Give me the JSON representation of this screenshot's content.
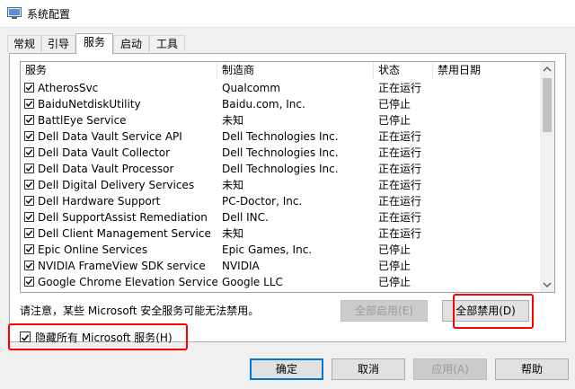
{
  "window": {
    "title": "系统配置"
  },
  "tabs": [
    "常规",
    "引导",
    "服务",
    "启动",
    "工具"
  ],
  "columns": {
    "service": "服务",
    "manufacturer": "制造商",
    "status": "状态",
    "disabled_date": "禁用日期"
  },
  "services": [
    {
      "name": "AtherosSvc",
      "manufacturer": "Qualcomm",
      "status": "正在运行",
      "checked": true
    },
    {
      "name": "BaiduNetdiskUtility",
      "manufacturer": "Baidu.com, Inc.",
      "status": "已停止",
      "checked": true
    },
    {
      "name": "BattlEye Service",
      "manufacturer": "未知",
      "status": "已停止",
      "checked": true
    },
    {
      "name": "Dell Data Vault Service API",
      "manufacturer": "Dell Technologies Inc.",
      "status": "正在运行",
      "checked": true
    },
    {
      "name": "Dell Data Vault Collector",
      "manufacturer": "Dell Technologies Inc.",
      "status": "正在运行",
      "checked": true
    },
    {
      "name": "Dell Data Vault Processor",
      "manufacturer": "Dell Technologies Inc.",
      "status": "正在运行",
      "checked": true
    },
    {
      "name": "Dell Digital Delivery Services",
      "manufacturer": "未知",
      "status": "正在运行",
      "checked": true
    },
    {
      "name": "Dell Hardware Support",
      "manufacturer": "PC-Doctor, Inc.",
      "status": "正在运行",
      "checked": true
    },
    {
      "name": "Dell SupportAssist Remediation",
      "manufacturer": "Dell INC.",
      "status": "正在运行",
      "checked": true
    },
    {
      "name": "Dell Client Management Service",
      "manufacturer": "未知",
      "status": "正在运行",
      "checked": true
    },
    {
      "name": "Epic Online Services",
      "manufacturer": "Epic Games, Inc.",
      "status": "已停止",
      "checked": true
    },
    {
      "name": "NVIDIA FrameView SDK service",
      "manufacturer": "NVIDIA",
      "status": "已停止",
      "checked": true
    },
    {
      "name": "Google Chrome Elevation Service (...",
      "manufacturer": "Google LLC",
      "status": "已停止",
      "checked": true
    }
  ],
  "notice": "请注意，某些 Microsoft 安全服务可能无法禁用。",
  "buttons": {
    "enable_all": "全部启用(E)",
    "disable_all": "全部禁用(D)",
    "ok": "确定",
    "cancel": "取消",
    "apply": "应用(A)",
    "help": "帮助"
  },
  "hide_ms": {
    "label": "隐藏所有 Microsoft 服务(H)",
    "checked": true
  },
  "colors": {
    "highlight": "#ff0000",
    "focus": "#0078d7"
  }
}
